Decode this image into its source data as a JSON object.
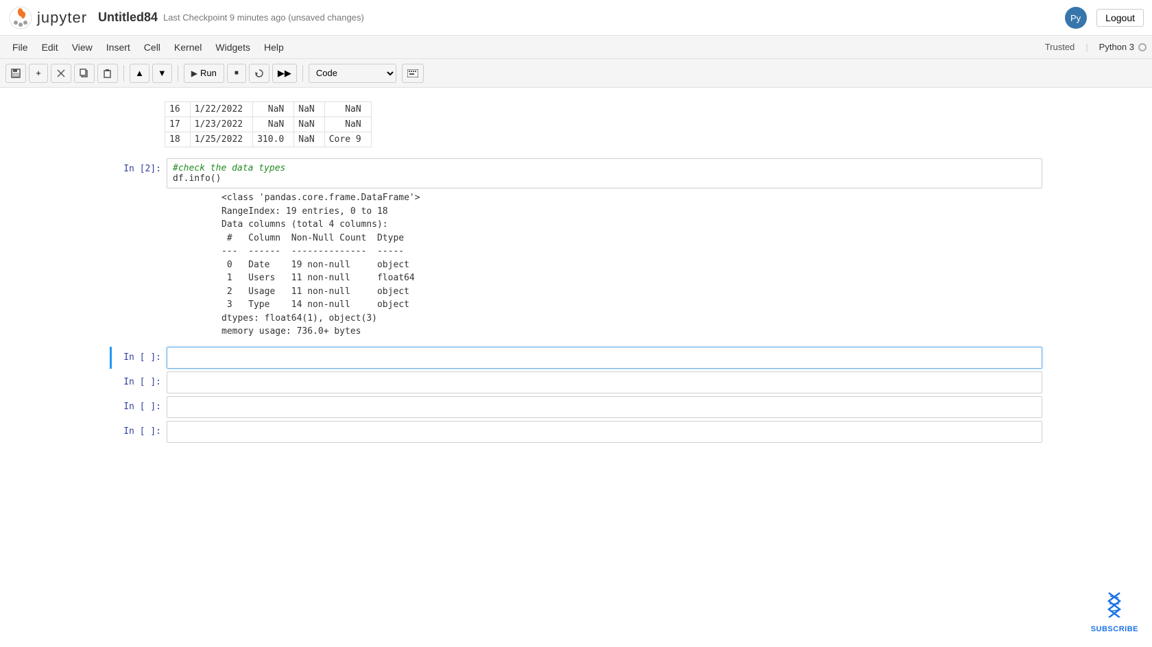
{
  "header": {
    "notebook_name": "Untitled84",
    "checkpoint_text": "Last Checkpoint",
    "checkpoint_time": "9 minutes ago",
    "unsaved_text": "(unsaved changes)",
    "logout_label": "Logout"
  },
  "menubar": {
    "items": [
      "File",
      "Edit",
      "View",
      "Insert",
      "Cell",
      "Kernel",
      "Widgets",
      "Help"
    ],
    "trusted_label": "Trusted",
    "kernel_label": "Python 3"
  },
  "toolbar": {
    "run_label": "Run",
    "cell_type": "Code"
  },
  "table": {
    "rows": [
      {
        "index": "16",
        "date": "1/22/2022",
        "users": "NaN",
        "usage": "NaN",
        "type": "NaN"
      },
      {
        "index": "17",
        "date": "1/23/2022",
        "users": "NaN",
        "usage": "NaN",
        "type": "NaN"
      },
      {
        "index": "18",
        "date": "1/25/2022",
        "users": "310.0",
        "usage": "NaN",
        "type": "Core 9"
      }
    ]
  },
  "cells": [
    {
      "id": "cell-in2",
      "prompt": "In [2]:",
      "code_comment": "#check the data types",
      "code_body": "df.info()",
      "output": "<class 'pandas.core.frame.DataFrame'>\nRangeIndex: 19 entries, 0 to 18\nData columns (total 4 columns):\n #   Column  Non-Null Count  Dtype\n---  ------  --------------  -----\n 0   Date    19 non-null     object\n 1   Users   11 non-null     float64\n 2   Usage   11 non-null     object\n 3   Type    14 non-null     object\ndtypes: float64(1), object(3)\nmemory usage: 736.0+ bytes"
    },
    {
      "id": "cell-empty1",
      "prompt": "In [ ]:",
      "code_body": "",
      "active": true
    },
    {
      "id": "cell-empty2",
      "prompt": "In [ ]:",
      "code_body": ""
    },
    {
      "id": "cell-empty3",
      "prompt": "In [ ]:",
      "code_body": ""
    },
    {
      "id": "cell-empty4",
      "prompt": "In [ ]:",
      "code_body": ""
    }
  ],
  "subscribe": {
    "label": "SUBSCRIBE"
  }
}
